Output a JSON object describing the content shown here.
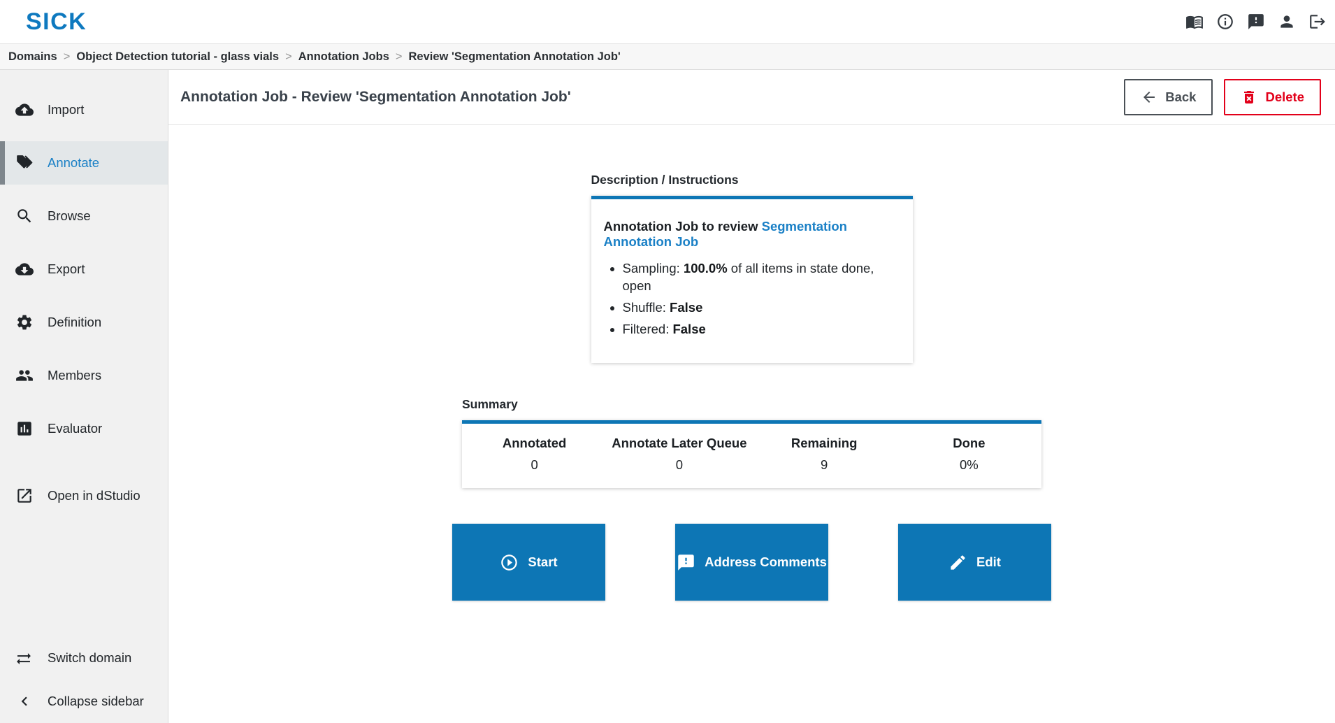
{
  "topbar": {
    "logo": "SICK",
    "icon_names": [
      "documentation-icon",
      "info-icon",
      "feedback-icon",
      "user-icon",
      "logout-icon"
    ]
  },
  "breadcrumb": {
    "separator": ">",
    "items": [
      "Domains",
      "Object Detection tutorial - glass vials",
      "Annotation Jobs",
      "Review 'Segmentation Annotation Job'"
    ]
  },
  "sidebar": {
    "items": [
      {
        "label": "Import"
      },
      {
        "label": "Annotate",
        "selected": true
      },
      {
        "label": "Browse"
      },
      {
        "label": "Export"
      },
      {
        "label": "Definition"
      },
      {
        "label": "Members"
      },
      {
        "label": "Evaluator"
      },
      {
        "label": "Open in dStudio"
      }
    ],
    "footer": [
      {
        "label": "Switch domain"
      },
      {
        "label": "Collapse sidebar"
      }
    ]
  },
  "header": {
    "title": "Annotation Job - Review 'Segmentation Annotation Job'",
    "back_label": "Back",
    "delete_label": "Delete"
  },
  "description": {
    "heading": "Description / Instructions",
    "intro_text": "Annotation Job to review ",
    "intro_link": "Segmentation Annotation Job",
    "bullets": [
      {
        "prefix": "Sampling: ",
        "bold": "100.0%",
        "suffix": " of all items in state done, open"
      },
      {
        "prefix": "Shuffle: ",
        "bold": "False",
        "suffix": ""
      },
      {
        "prefix": "Filtered: ",
        "bold": "False",
        "suffix": ""
      }
    ]
  },
  "summary": {
    "heading": "Summary",
    "columns": [
      {
        "label": "Annotated",
        "value": "0"
      },
      {
        "label": "Annotate Later Queue",
        "value": "0"
      },
      {
        "label": "Remaining",
        "value": "9"
      },
      {
        "label": "Done",
        "value": "0%"
      }
    ]
  },
  "actions": [
    {
      "label": "Start"
    },
    {
      "label": "Address Comments"
    },
    {
      "label": "Edit"
    }
  ],
  "colors": {
    "brand_blue": "#0e79bf",
    "accent_blue": "#0d76b5",
    "link_blue": "#1a80c6",
    "delete_red": "#e2001a",
    "sidebar_bg": "#f1f1f1",
    "sidebar_selected_bg": "#e3e7e9"
  }
}
